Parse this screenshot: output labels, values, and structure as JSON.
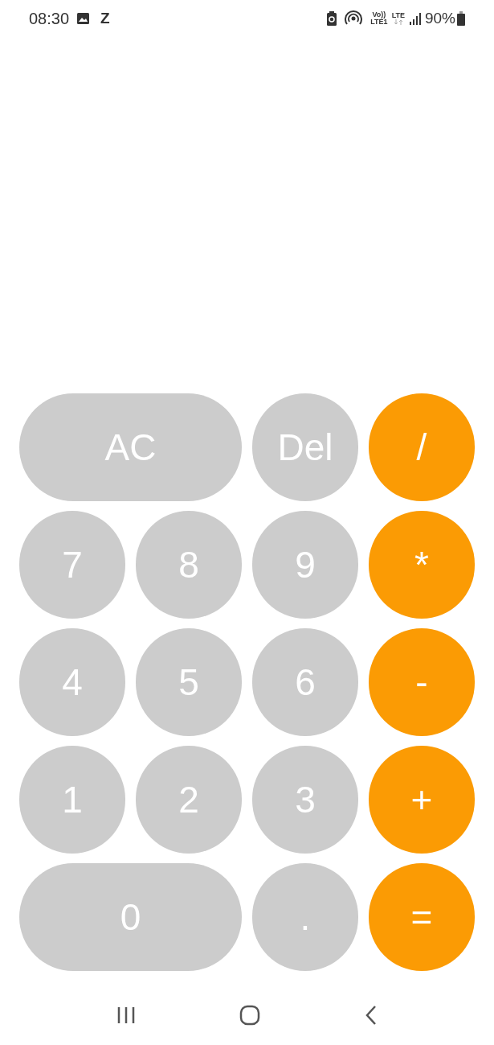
{
  "status_bar": {
    "time": "08:30",
    "app_letter": "Z",
    "volte_top": "Vo))",
    "volte_bottom": "LTE1",
    "network": "LTE",
    "battery": "90%"
  },
  "keys": [
    {
      "label": "AC",
      "kind": "function",
      "wide": true
    },
    {
      "label": "Del",
      "kind": "function",
      "wide": false
    },
    {
      "label": "/",
      "kind": "operator",
      "wide": false
    },
    {
      "label": "7",
      "kind": "digit",
      "wide": false
    },
    {
      "label": "8",
      "kind": "digit",
      "wide": false
    },
    {
      "label": "9",
      "kind": "digit",
      "wide": false
    },
    {
      "label": "*",
      "kind": "operator",
      "wide": false
    },
    {
      "label": "4",
      "kind": "digit",
      "wide": false
    },
    {
      "label": "5",
      "kind": "digit",
      "wide": false
    },
    {
      "label": "6",
      "kind": "digit",
      "wide": false
    },
    {
      "label": "-",
      "kind": "operator",
      "wide": false
    },
    {
      "label": "1",
      "kind": "digit",
      "wide": false
    },
    {
      "label": "2",
      "kind": "digit",
      "wide": false
    },
    {
      "label": "3",
      "kind": "digit",
      "wide": false
    },
    {
      "label": "+",
      "kind": "operator",
      "wide": false
    },
    {
      "label": "0",
      "kind": "digit",
      "wide": true
    },
    {
      "label": ".",
      "kind": "digit",
      "wide": false
    },
    {
      "label": "=",
      "kind": "operator",
      "wide": false
    }
  ]
}
